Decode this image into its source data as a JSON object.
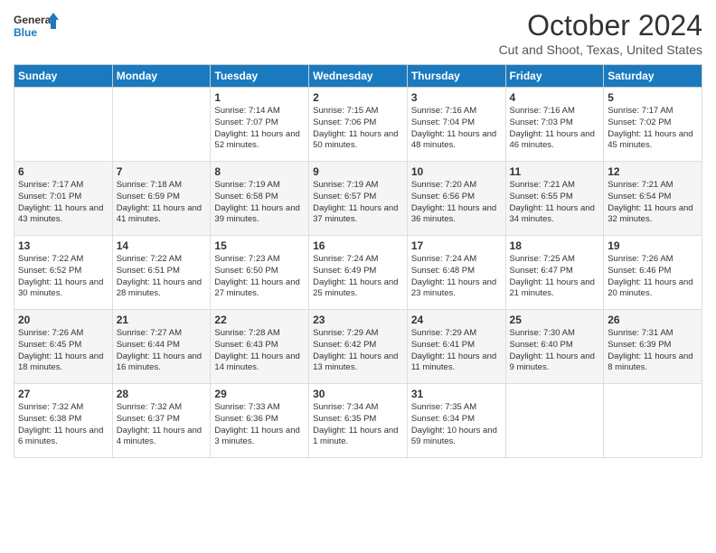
{
  "logo": {
    "line1": "General",
    "line2": "Blue"
  },
  "title": "October 2024",
  "location": "Cut and Shoot, Texas, United States",
  "days_header": [
    "Sunday",
    "Monday",
    "Tuesday",
    "Wednesday",
    "Thursday",
    "Friday",
    "Saturday"
  ],
  "weeks": [
    [
      {
        "day": "",
        "info": ""
      },
      {
        "day": "",
        "info": ""
      },
      {
        "day": "1",
        "info": "Sunrise: 7:14 AM\nSunset: 7:07 PM\nDaylight: 11 hours and 52 minutes."
      },
      {
        "day": "2",
        "info": "Sunrise: 7:15 AM\nSunset: 7:06 PM\nDaylight: 11 hours and 50 minutes."
      },
      {
        "day": "3",
        "info": "Sunrise: 7:16 AM\nSunset: 7:04 PM\nDaylight: 11 hours and 48 minutes."
      },
      {
        "day": "4",
        "info": "Sunrise: 7:16 AM\nSunset: 7:03 PM\nDaylight: 11 hours and 46 minutes."
      },
      {
        "day": "5",
        "info": "Sunrise: 7:17 AM\nSunset: 7:02 PM\nDaylight: 11 hours and 45 minutes."
      }
    ],
    [
      {
        "day": "6",
        "info": "Sunrise: 7:17 AM\nSunset: 7:01 PM\nDaylight: 11 hours and 43 minutes."
      },
      {
        "day": "7",
        "info": "Sunrise: 7:18 AM\nSunset: 6:59 PM\nDaylight: 11 hours and 41 minutes."
      },
      {
        "day": "8",
        "info": "Sunrise: 7:19 AM\nSunset: 6:58 PM\nDaylight: 11 hours and 39 minutes."
      },
      {
        "day": "9",
        "info": "Sunrise: 7:19 AM\nSunset: 6:57 PM\nDaylight: 11 hours and 37 minutes."
      },
      {
        "day": "10",
        "info": "Sunrise: 7:20 AM\nSunset: 6:56 PM\nDaylight: 11 hours and 36 minutes."
      },
      {
        "day": "11",
        "info": "Sunrise: 7:21 AM\nSunset: 6:55 PM\nDaylight: 11 hours and 34 minutes."
      },
      {
        "day": "12",
        "info": "Sunrise: 7:21 AM\nSunset: 6:54 PM\nDaylight: 11 hours and 32 minutes."
      }
    ],
    [
      {
        "day": "13",
        "info": "Sunrise: 7:22 AM\nSunset: 6:52 PM\nDaylight: 11 hours and 30 minutes."
      },
      {
        "day": "14",
        "info": "Sunrise: 7:22 AM\nSunset: 6:51 PM\nDaylight: 11 hours and 28 minutes."
      },
      {
        "day": "15",
        "info": "Sunrise: 7:23 AM\nSunset: 6:50 PM\nDaylight: 11 hours and 27 minutes."
      },
      {
        "day": "16",
        "info": "Sunrise: 7:24 AM\nSunset: 6:49 PM\nDaylight: 11 hours and 25 minutes."
      },
      {
        "day": "17",
        "info": "Sunrise: 7:24 AM\nSunset: 6:48 PM\nDaylight: 11 hours and 23 minutes."
      },
      {
        "day": "18",
        "info": "Sunrise: 7:25 AM\nSunset: 6:47 PM\nDaylight: 11 hours and 21 minutes."
      },
      {
        "day": "19",
        "info": "Sunrise: 7:26 AM\nSunset: 6:46 PM\nDaylight: 11 hours and 20 minutes."
      }
    ],
    [
      {
        "day": "20",
        "info": "Sunrise: 7:26 AM\nSunset: 6:45 PM\nDaylight: 11 hours and 18 minutes."
      },
      {
        "day": "21",
        "info": "Sunrise: 7:27 AM\nSunset: 6:44 PM\nDaylight: 11 hours and 16 minutes."
      },
      {
        "day": "22",
        "info": "Sunrise: 7:28 AM\nSunset: 6:43 PM\nDaylight: 11 hours and 14 minutes."
      },
      {
        "day": "23",
        "info": "Sunrise: 7:29 AM\nSunset: 6:42 PM\nDaylight: 11 hours and 13 minutes."
      },
      {
        "day": "24",
        "info": "Sunrise: 7:29 AM\nSunset: 6:41 PM\nDaylight: 11 hours and 11 minutes."
      },
      {
        "day": "25",
        "info": "Sunrise: 7:30 AM\nSunset: 6:40 PM\nDaylight: 11 hours and 9 minutes."
      },
      {
        "day": "26",
        "info": "Sunrise: 7:31 AM\nSunset: 6:39 PM\nDaylight: 11 hours and 8 minutes."
      }
    ],
    [
      {
        "day": "27",
        "info": "Sunrise: 7:32 AM\nSunset: 6:38 PM\nDaylight: 11 hours and 6 minutes."
      },
      {
        "day": "28",
        "info": "Sunrise: 7:32 AM\nSunset: 6:37 PM\nDaylight: 11 hours and 4 minutes."
      },
      {
        "day": "29",
        "info": "Sunrise: 7:33 AM\nSunset: 6:36 PM\nDaylight: 11 hours and 3 minutes."
      },
      {
        "day": "30",
        "info": "Sunrise: 7:34 AM\nSunset: 6:35 PM\nDaylight: 11 hours and 1 minute."
      },
      {
        "day": "31",
        "info": "Sunrise: 7:35 AM\nSunset: 6:34 PM\nDaylight: 10 hours and 59 minutes."
      },
      {
        "day": "",
        "info": ""
      },
      {
        "day": "",
        "info": ""
      }
    ]
  ]
}
